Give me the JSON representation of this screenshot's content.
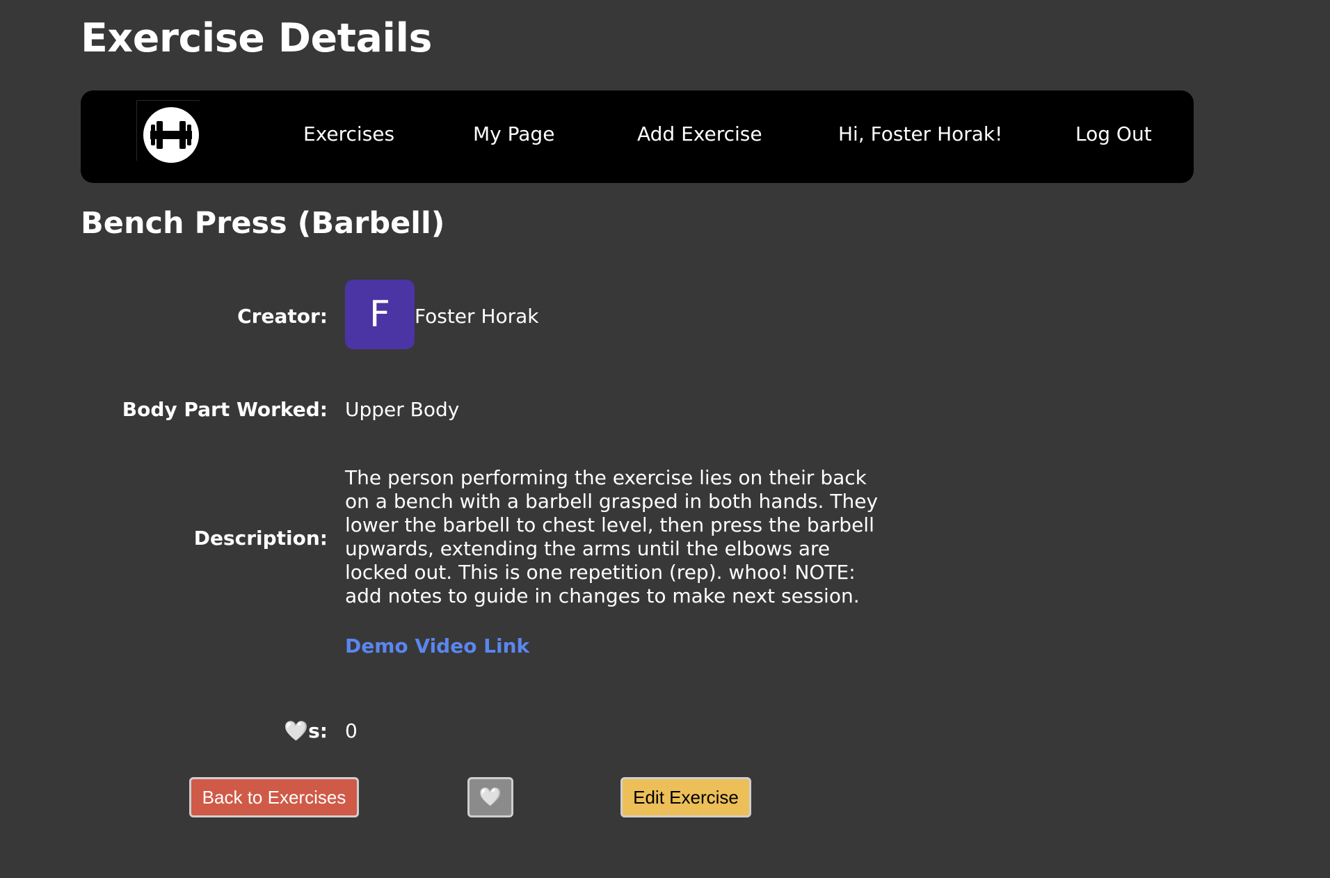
{
  "page": {
    "title": "Exercise Details"
  },
  "nav": {
    "logo_icon": "dumbbell-icon",
    "items": [
      {
        "label": "Exercises"
      },
      {
        "label": "My Page"
      },
      {
        "label": "Add Exercise"
      },
      {
        "label": "Hi, Foster Horak!"
      },
      {
        "label": "Log Out"
      }
    ]
  },
  "exercise": {
    "name": "Bench Press (Barbell)",
    "creator_label": "Creator:",
    "creator_initial": "F",
    "creator_name": "Foster Horak",
    "body_part_label": "Body Part Worked:",
    "body_part": "Upper Body",
    "description_label": "Description:",
    "description": "The person performing the exercise lies on their back on a bench with a barbell grasped in both hands. They lower the barbell to chest level, then press the barbell upwards, extending the arms until the elbows are locked out. This is one repetition (rep). whoo! NOTE: add notes to guide in changes to make next session.",
    "demo_link": "Demo Video Link",
    "likes_heart": "🤍",
    "likes_label_suffix": "s:",
    "likes_count": "0"
  },
  "buttons": {
    "back": "Back to Exercises",
    "like_icon": "🤍",
    "edit": "Edit Exercise"
  },
  "colors": {
    "background": "#383838",
    "navbar": "#000000",
    "avatar": "#4b34a3",
    "link": "#5b86f0",
    "back_button": "#cf5a47",
    "like_button": "#8b8b8b",
    "edit_button": "#ecbf58"
  }
}
